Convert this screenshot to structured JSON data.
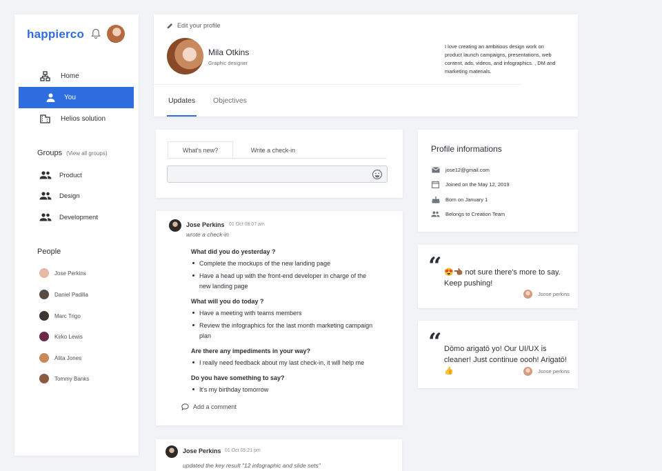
{
  "brand": {
    "logo_text": "happierco"
  },
  "sidebar": {
    "nav": [
      {
        "label": "Home",
        "icon": "hierarchy-icon"
      },
      {
        "label": "You",
        "icon": "person-icon",
        "active": true
      },
      {
        "label": "Helios solution",
        "icon": "building-icon"
      }
    ],
    "groups_title": "Groups",
    "groups_link": "(View all groups)",
    "groups": [
      {
        "label": "Product",
        "icon": "group-icon"
      },
      {
        "label": "Design",
        "icon": "group-icon"
      },
      {
        "label": "Development",
        "icon": "group-icon"
      }
    ],
    "people_title": "People",
    "people": [
      {
        "name": "Jose Perkins",
        "color": "#e6b8a6"
      },
      {
        "name": "Daniel Padilla",
        "color": "#5a4a44"
      },
      {
        "name": "Marc Trigo",
        "color": "#3b3634"
      },
      {
        "name": "Kirko Lewis",
        "color": "#6a2a4a"
      },
      {
        "name": "Alita Jones",
        "color": "#c98a5a"
      },
      {
        "name": "Tommy Banks",
        "color": "#8a5a44"
      }
    ]
  },
  "profile": {
    "edit_label": "Edit your profile",
    "name": "Mila Otkins",
    "role": "Graphic designer",
    "bio": "I love creating an ambitious design work on product launch campaigns, presentations, web content, ads, videos, and infographics. , DM and marketing materials.",
    "tabs": [
      "Updates",
      "Objectives"
    ]
  },
  "compose": {
    "tabs": [
      "What's new?",
      "Write a check-in"
    ],
    "value": ""
  },
  "feed": {
    "post1": {
      "author": "Jose Perkins",
      "time": "01 Oct 08:07 am",
      "action": "wrote a check-in",
      "q1": "What did you do yesterday ?",
      "a1_1": "Complete the mockups of the new landing page",
      "a1_2": "Have a head up with the front-end developer in charge of the new landing page",
      "q2": "What will you do today ?",
      "a2_1": "Have a meeting with teams members",
      "a2_2": "Review the infographics for the last month marketing campaign plan",
      "q3": "Are there any impediments in your way?",
      "a3_1": "I really need feedback about my last check-in, it will help me",
      "q4": "Do you have something to say?",
      "a4_1": "It's my birthday tomorrow",
      "add_comment": "Add a comment"
    },
    "post2": {
      "author": "Jose Perkins",
      "time": "01 Oct 05:21 pm",
      "action": "updated the key result \"12 infographic and slide sets\""
    }
  },
  "profile_info": {
    "title": "Profile informations",
    "email": "jose12@gmail.com",
    "joined": "Joined on the May 12, 2019",
    "born": "Born on January 1",
    "team": "Belongs to Creation Team"
  },
  "quotes": [
    {
      "text": "😍👈🏾 not sure there's more to say. Keep pushing!",
      "author": "Jsose perkins"
    },
    {
      "text": "Dōmo arigatō yo! Our UI/UX is cleaner! Just continue oooh! Arigatō!👍",
      "author": "Jsose perkins"
    }
  ],
  "colors": {
    "accent": "#2d6de0",
    "logo_ball": "#f4c21f"
  }
}
